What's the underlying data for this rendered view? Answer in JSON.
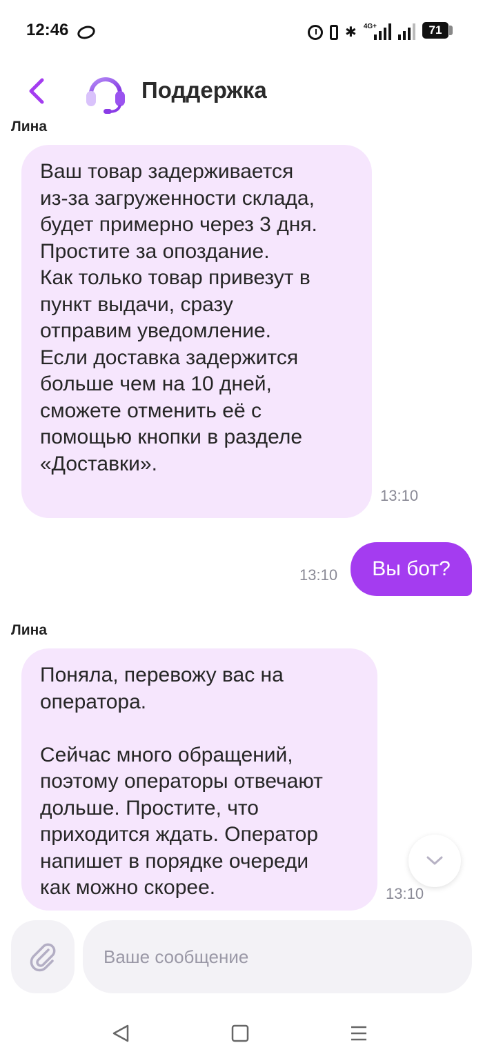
{
  "status_bar": {
    "time": "12:46",
    "network": "4G+",
    "battery": "71"
  },
  "header": {
    "title": "Поддержка"
  },
  "chat": {
    "partial_sender": "Лина",
    "messages": [
      {
        "direction": "incoming",
        "text": "Ваш товар задерживается\nиз-за загруженности склада,\nбудет примерно через 3 дня.\nПростите за опоздание.\nКак только товар привезут в\nпункт выдачи, сразу\nотправим уведомление.\nЕсли доставка задержится\nбольше чем на 10 дней,\nсможете отменить её с\nпомощью кнопки в разделе\n«Доставки».",
        "time": "13:10"
      },
      {
        "direction": "outgoing",
        "text": "Вы бот?",
        "time": "13:10"
      },
      {
        "direction": "incoming",
        "sender": "Лина",
        "text": "Поняла, перевожу вас на\nоператора.\n\nСейчас много обращений,\nпоэтому операторы отвечают\nдольше. Простите, что\nприходится ждать. Оператор\nнапишет в порядке очереди\nкак можно скорее.",
        "time": "13:10"
      }
    ]
  },
  "composer": {
    "placeholder": "Ваше сообщение"
  },
  "colors": {
    "accent": "#a43cf0",
    "incoming_bubble": "#f6e6fd",
    "input_bg": "#f3f2f6"
  },
  "icons": {
    "back": "chevron-left-icon",
    "avatar": "headset-icon",
    "scroll": "chevron-down-icon",
    "attach": "paperclip-icon",
    "nav": [
      "triangle-back-icon",
      "square-home-icon",
      "menu-lines-icon"
    ]
  }
}
